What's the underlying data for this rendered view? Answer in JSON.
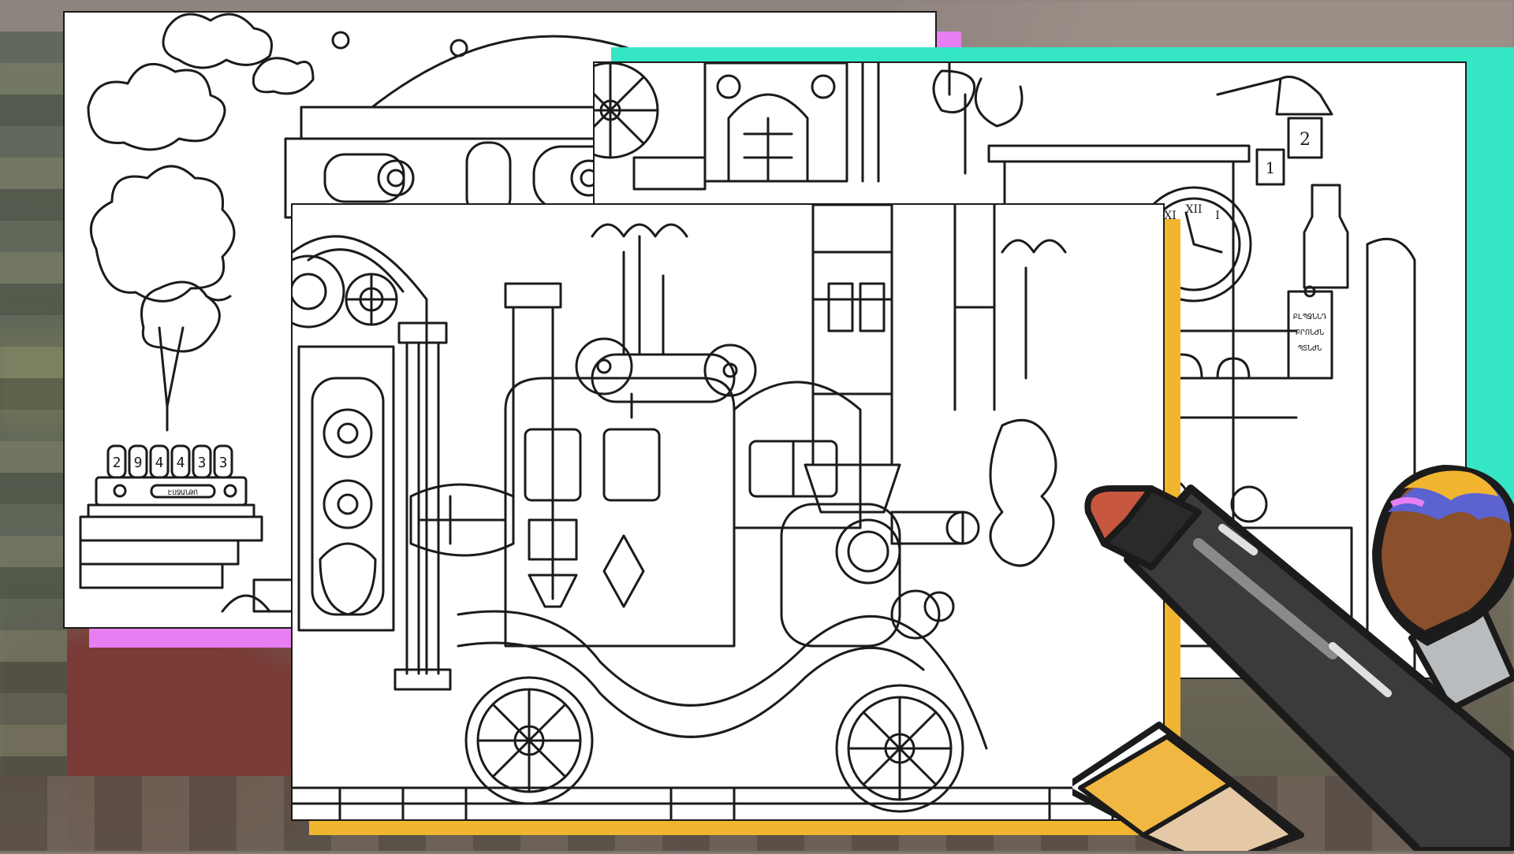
{
  "colors": {
    "pink_accent": "#e77ff2",
    "teal_accent": "#35e6c4",
    "yellow_accent": "#f2b530",
    "outline": "#1b1b1b",
    "page": "#ffffff"
  },
  "page1": {
    "nixie_digits": [
      "2",
      "9",
      "4",
      "4",
      "3",
      "3"
    ],
    "plaque_text": "ԷՍՋԱՆԹՈ"
  },
  "page2": {
    "clock_numerals": [
      "XI",
      "XII",
      "I"
    ],
    "tag_1": "1",
    "tag_2": "2",
    "sign_lines": [
      "ԲԼՊՋՆՆԴ",
      "ԲՐՈՆԺՆ",
      "ՊՏՆԺՆ"
    ]
  },
  "icons": {
    "marker": "marker-icon",
    "paintbrush": "paintbrush-icon",
    "pencil": "pencil-icon"
  }
}
